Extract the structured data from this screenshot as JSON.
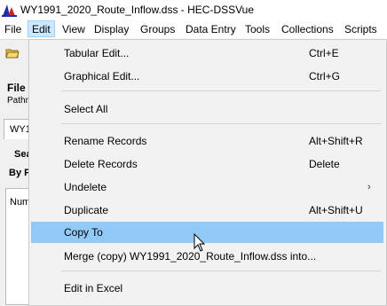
{
  "window": {
    "title": "WY1991_2020_Route_Inflow.dss - HEC-DSSVue"
  },
  "menubar": {
    "items": [
      {
        "label": "File"
      },
      {
        "label": "Edit"
      },
      {
        "label": "View"
      },
      {
        "label": "Display"
      },
      {
        "label": "Groups"
      },
      {
        "label": "Data Entry"
      },
      {
        "label": "Tools"
      },
      {
        "label": "Collections"
      },
      {
        "label": "Scripts"
      }
    ]
  },
  "background": {
    "file_label": "File",
    "path_label": "Pathn",
    "tab_label": "WY1",
    "search_label": "Sea",
    "by_label": "By P",
    "num_label": "Num"
  },
  "edit_menu": {
    "items": [
      {
        "label": "Tabular Edit...",
        "shortcut": "Ctrl+E"
      },
      {
        "label": "Graphical Edit...",
        "shortcut": "Ctrl+G"
      },
      {
        "label": "Select All",
        "shortcut": ""
      },
      {
        "label": "Rename Records",
        "shortcut": "Alt+Shift+R"
      },
      {
        "label": "Delete Records",
        "shortcut": "Delete"
      },
      {
        "label": "Undelete",
        "shortcut": "",
        "submenu": "›"
      },
      {
        "label": "Duplicate",
        "shortcut": "Alt+Shift+U"
      },
      {
        "label": "Copy To",
        "shortcut": "",
        "highlighted": true
      },
      {
        "label": "Merge (copy) WY1991_2020_Route_Inflow.dss into...",
        "shortcut": ""
      },
      {
        "label": "Edit in Excel",
        "shortcut": ""
      }
    ]
  },
  "colors": {
    "highlight": "#91c9f7",
    "menu_bg": "#f2f2f2",
    "edit_active": "#cce8ff"
  }
}
